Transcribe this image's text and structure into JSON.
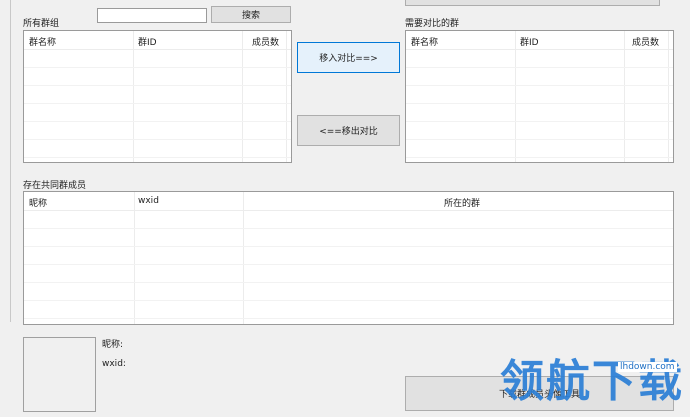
{
  "groups_panel": {
    "label": "所有群组",
    "search_value": "",
    "search_button": "搜索",
    "columns": [
      "群名称",
      "群ID",
      "成员数"
    ]
  },
  "compare_panel": {
    "label": "需要对比的群",
    "columns": [
      "群名称",
      "群ID",
      "成员数"
    ]
  },
  "actions": {
    "move_in": "移入对比==>",
    "move_out": "<==移出对比"
  },
  "common_members": {
    "label": "存在共同群成员",
    "columns": [
      "昵称",
      "wxid",
      "所在的群"
    ]
  },
  "detail": {
    "nickname_label": "昵称:",
    "wxid_label": "wxid:"
  },
  "download_button": "下载群成员头像工具",
  "watermark": {
    "text": "领航下载",
    "url": "lhdown.com"
  }
}
